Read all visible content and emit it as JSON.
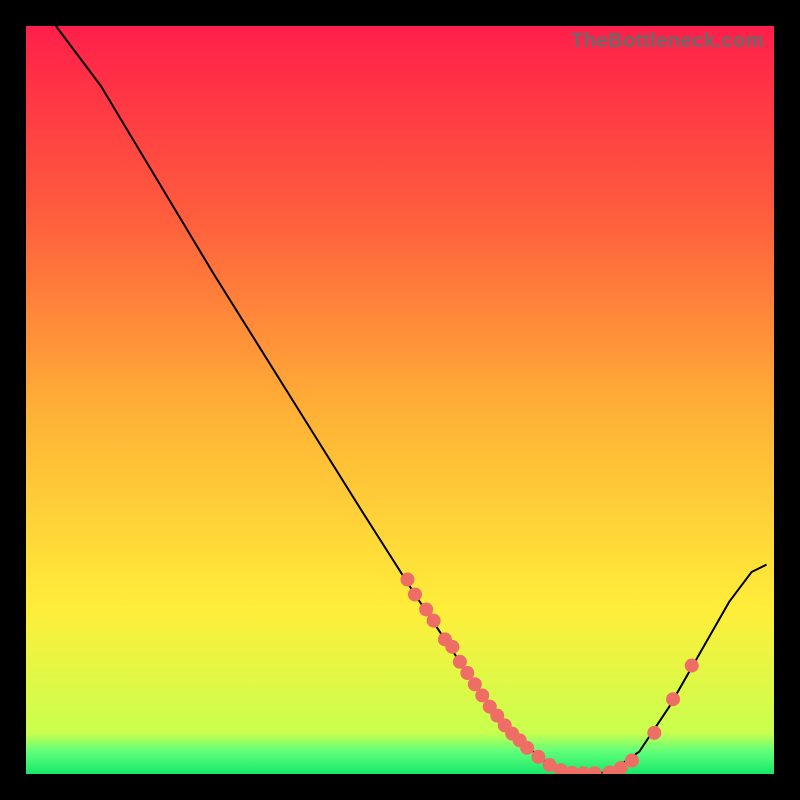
{
  "watermark": "TheBottleneck.com",
  "gradient": {
    "top": "#ff1f4a",
    "upper": "#ff5c3d",
    "mid": "#ffb236",
    "lower": "#ffee3a",
    "green_top": "#c9ff4e",
    "green_mid": "#5fff7a",
    "green_bot": "#17e86a"
  },
  "chart_data": {
    "type": "line",
    "title": "",
    "xlabel": "",
    "ylabel": "",
    "xlim": [
      0,
      100
    ],
    "ylim": [
      0,
      100
    ],
    "curve": [
      {
        "x": 4,
        "y": 100
      },
      {
        "x": 10,
        "y": 92
      },
      {
        "x": 16,
        "y": 82
      },
      {
        "x": 25,
        "y": 67
      },
      {
        "x": 35,
        "y": 51
      },
      {
        "x": 45,
        "y": 35
      },
      {
        "x": 52,
        "y": 24
      },
      {
        "x": 58,
        "y": 15
      },
      {
        "x": 62,
        "y": 9
      },
      {
        "x": 66,
        "y": 4.5
      },
      {
        "x": 70,
        "y": 1.2
      },
      {
        "x": 74,
        "y": 0.1
      },
      {
        "x": 78,
        "y": 0.2
      },
      {
        "x": 82,
        "y": 3
      },
      {
        "x": 86,
        "y": 9
      },
      {
        "x": 90,
        "y": 16
      },
      {
        "x": 94,
        "y": 23
      },
      {
        "x": 97,
        "y": 27
      },
      {
        "x": 99,
        "y": 28
      }
    ],
    "points": [
      {
        "x": 51,
        "y": 26
      },
      {
        "x": 52,
        "y": 24
      },
      {
        "x": 53.5,
        "y": 22
      },
      {
        "x": 54.5,
        "y": 20.5
      },
      {
        "x": 56,
        "y": 18
      },
      {
        "x": 57,
        "y": 17
      },
      {
        "x": 58,
        "y": 15
      },
      {
        "x": 59,
        "y": 13.5
      },
      {
        "x": 60,
        "y": 12
      },
      {
        "x": 61,
        "y": 10.5
      },
      {
        "x": 62,
        "y": 9
      },
      {
        "x": 63,
        "y": 7.8
      },
      {
        "x": 64,
        "y": 6.5
      },
      {
        "x": 65,
        "y": 5.4
      },
      {
        "x": 66,
        "y": 4.5
      },
      {
        "x": 67,
        "y": 3.5
      },
      {
        "x": 68.5,
        "y": 2.3
      },
      {
        "x": 70,
        "y": 1.2
      },
      {
        "x": 71.5,
        "y": 0.5
      },
      {
        "x": 73,
        "y": 0.15
      },
      {
        "x": 74.5,
        "y": 0.1
      },
      {
        "x": 76,
        "y": 0.1
      },
      {
        "x": 78,
        "y": 0.2
      },
      {
        "x": 79.5,
        "y": 0.8
      },
      {
        "x": 81,
        "y": 1.8
      },
      {
        "x": 84,
        "y": 5.5
      },
      {
        "x": 86.5,
        "y": 10
      },
      {
        "x": 89,
        "y": 14.5
      }
    ],
    "point_color": "#ee6e66",
    "curve_color": "#000000"
  }
}
